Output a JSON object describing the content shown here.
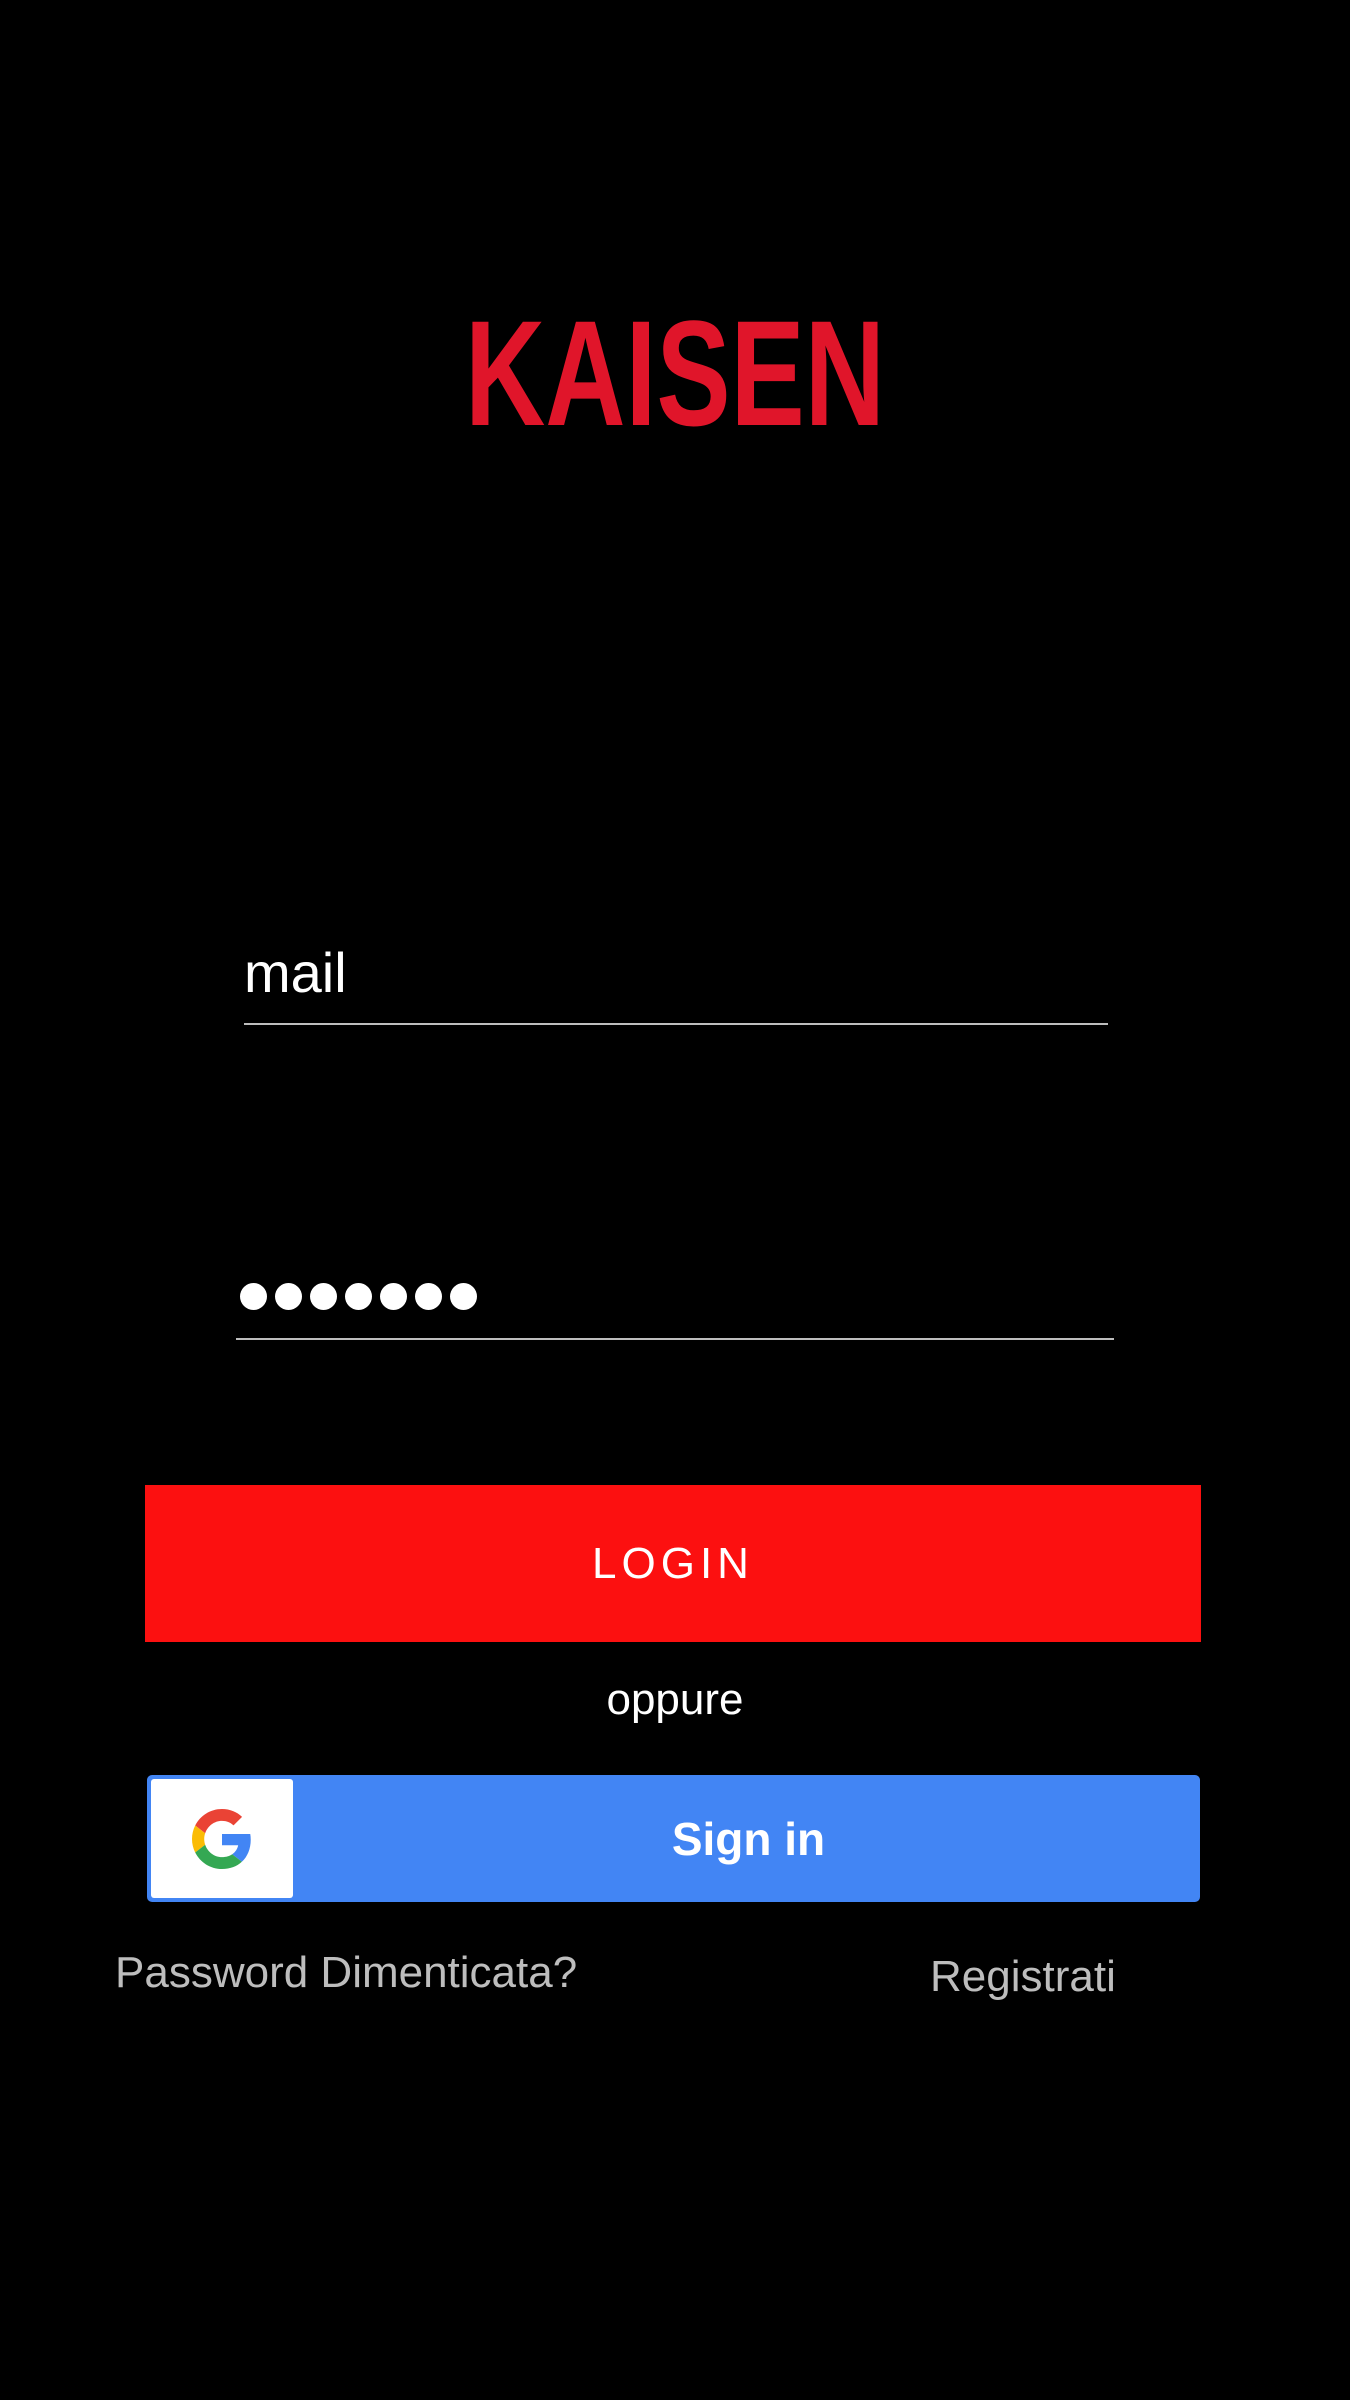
{
  "app": {
    "logo_text": "KAISEN",
    "brand_color": "#e0152a"
  },
  "login_form": {
    "email_field_value": "mail",
    "password_masked_length": 7,
    "login_button_label": "LOGIN",
    "separator_text": "oppure",
    "google_button_label": "Sign in",
    "google_icon": "google-g-icon",
    "forgot_password_link": "Password Dimenticata?",
    "register_link": "Registrati"
  },
  "colors": {
    "background": "#000000",
    "login_button": "#fc1010",
    "google_button": "#4285f4",
    "link_text": "#bdbdbd",
    "field_underline": "#bdbdbd"
  }
}
